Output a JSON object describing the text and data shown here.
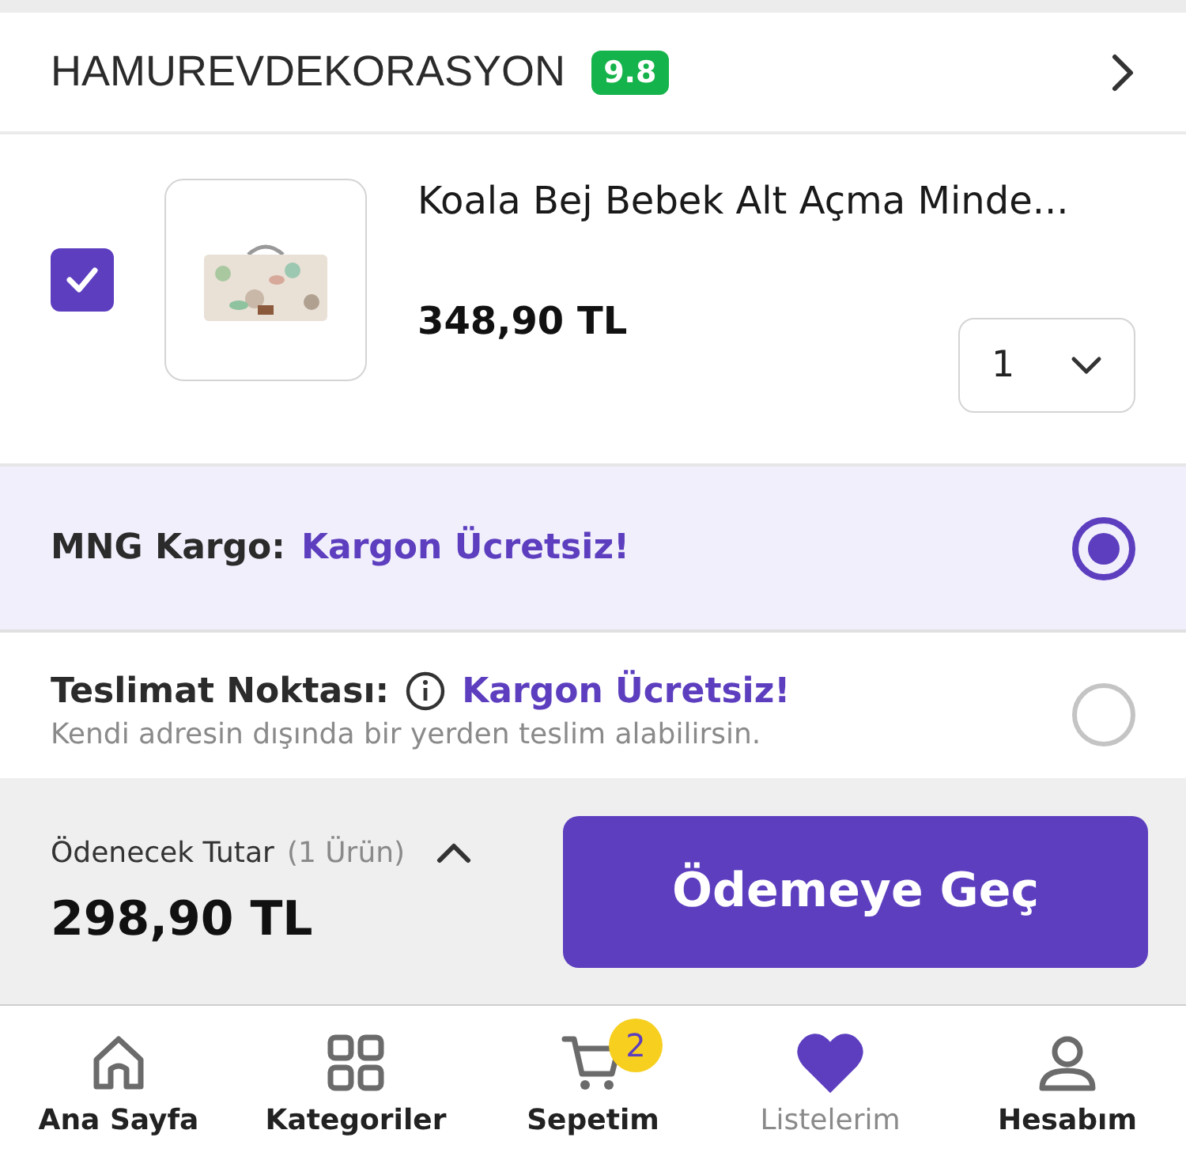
{
  "seller": {
    "name": "HAMUREVDEKORASYON",
    "rating": "9.8"
  },
  "product": {
    "checked": true,
    "title": "Koala Bej Bebek Alt Açma Minde...",
    "price": "348,90 TL",
    "quantity": "1"
  },
  "shipping_options": [
    {
      "label": "MNG Kargo:",
      "info_icon": false,
      "offer": "Kargon Ücretsiz!",
      "selected": true
    },
    {
      "label": "Teslimat Noktası:",
      "info_icon": true,
      "offer": "Kargon Ücretsiz!",
      "note": "Kendi adresin dışında bir yerden teslim alabilirsin.",
      "selected": false
    }
  ],
  "summary": {
    "label": "Ödenecek Tutar",
    "count": "(1 Ürün)",
    "total": "298,90 TL",
    "button": "Ödemeye Geç"
  },
  "nav": [
    {
      "kind": "home",
      "label": "Ana Sayfa",
      "selected": false
    },
    {
      "kind": "grid",
      "label": "Kategoriler",
      "selected": false
    },
    {
      "kind": "cart",
      "label": "Sepetim",
      "badge": "2",
      "selected": false
    },
    {
      "kind": "heart",
      "label": "Listelerim",
      "selected": true
    },
    {
      "kind": "user",
      "label": "Hesabım",
      "selected": false
    }
  ]
}
